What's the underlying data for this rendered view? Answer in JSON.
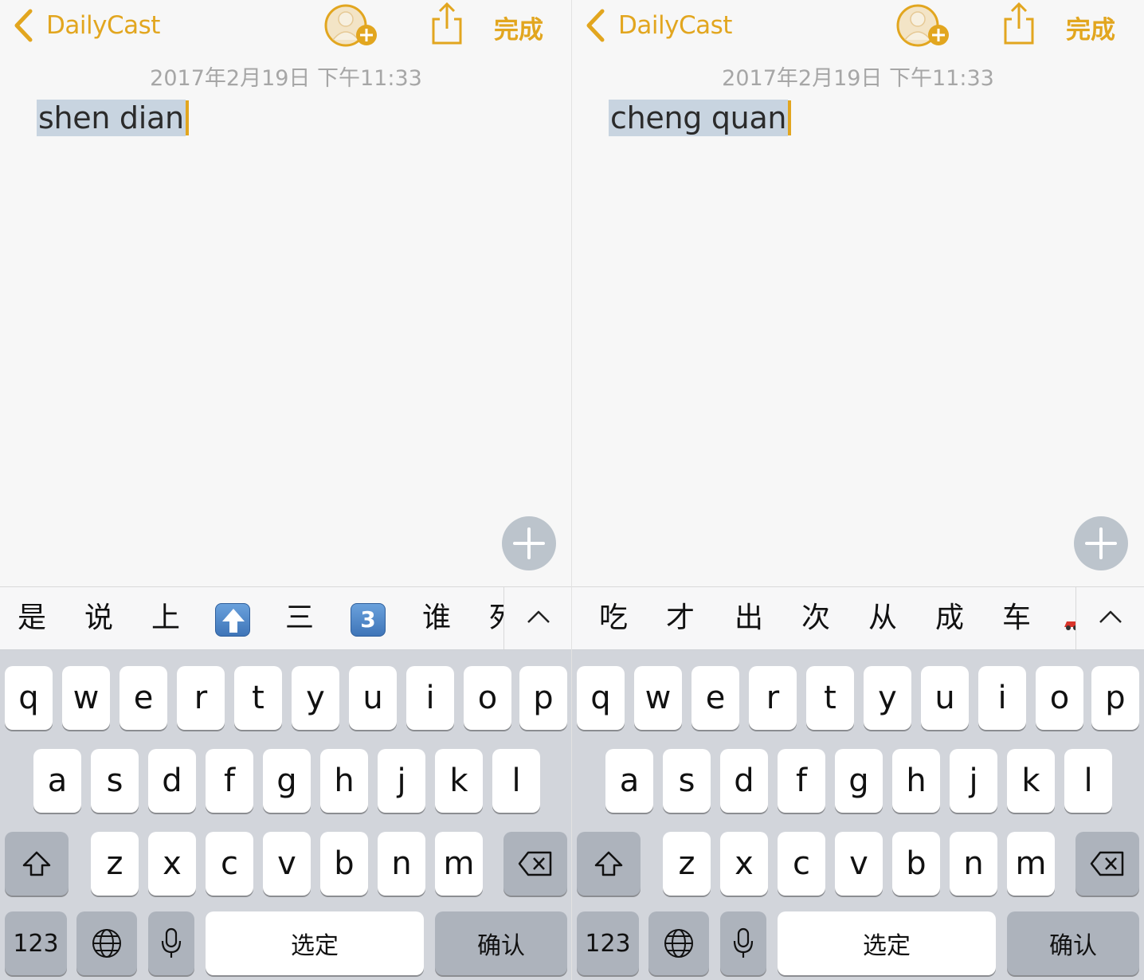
{
  "screens": [
    {
      "nav": {
        "back_label": "DailyCast",
        "done_label": "完成"
      },
      "date": "2017年2月19日 下午11:33",
      "note_text": "shen dian",
      "candidates": [
        "是",
        "说",
        "上",
        "⬆",
        "三",
        "3",
        "谁",
        "死"
      ],
      "candidate_types": [
        "text",
        "text",
        "text",
        "emoji-up-arrow",
        "text",
        "emoji-keycap",
        "text",
        "text-clipped"
      ]
    },
    {
      "nav": {
        "back_label": "DailyCast",
        "done_label": "完成"
      },
      "date": "2017年2月19日 下午11:33",
      "note_text": "cheng quan",
      "candidates": [
        "吃",
        "才",
        "出",
        "次",
        "从",
        "成",
        "车"
      ],
      "candidate_types": [
        "text",
        "text",
        "text",
        "text",
        "text",
        "text",
        "text"
      ],
      "trailing_emoji": "red-car-icon"
    }
  ],
  "keyboard": {
    "row1": [
      "q",
      "w",
      "e",
      "r",
      "t",
      "y",
      "u",
      "i",
      "o",
      "p"
    ],
    "row2": [
      "a",
      "s",
      "d",
      "f",
      "g",
      "h",
      "j",
      "k",
      "l"
    ],
    "row3": [
      "z",
      "x",
      "c",
      "v",
      "b",
      "n",
      "m"
    ],
    "numbers_label": "123",
    "space_label": "选定",
    "return_label": "确认"
  },
  "colors": {
    "accent": "#e2a61f",
    "selection": "#c8d4e0",
    "keyboard_bg": "#d2d5db",
    "key_dark": "#adb3bc",
    "fab": "#bcc4cc"
  },
  "icons": [
    "chevron-left-icon",
    "add-person-icon",
    "share-icon",
    "plus-icon",
    "chevron-up-icon",
    "shift-icon",
    "delete-icon",
    "globe-icon",
    "microphone-icon"
  ]
}
